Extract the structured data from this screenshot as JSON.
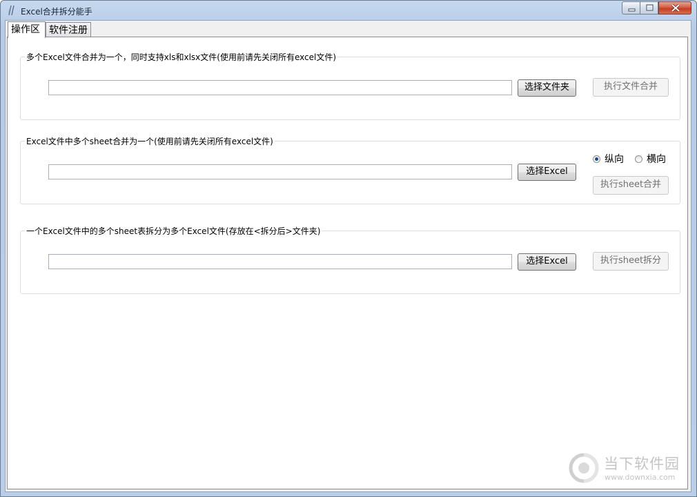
{
  "window": {
    "title": "Excel合并拆分能手",
    "controls": {
      "minimize_icon": "minimize-icon",
      "maximize_icon": "maximize-icon",
      "close_icon": "close-icon"
    }
  },
  "tabs": [
    {
      "label": "操作区",
      "active": true
    },
    {
      "label": "软件注册",
      "active": false
    }
  ],
  "groups": {
    "merge_files": {
      "title": "多个Excel文件合并为一个，同时支持xls和xlsx文件(使用前请先关闭所有excel文件)",
      "path_value": "",
      "select_label": "选择文件夹",
      "run_label": "执行文件合并"
    },
    "merge_sheets": {
      "title": "Excel文件中多个sheet合并为一个(使用前请先关闭所有excel文件)",
      "path_value": "",
      "select_label": "选择Excel",
      "run_label": "执行sheet合并",
      "orientation": {
        "options": [
          "纵向",
          "横向"
        ],
        "selected": "纵向"
      }
    },
    "split_sheets": {
      "title": "一个Excel文件中的多个sheet表拆分为多个Excel文件(存放在<拆分后>文件夹)",
      "path_value": "",
      "select_label": "选择Excel",
      "run_label": "执行sheet拆分"
    }
  },
  "watermark": {
    "name": "当下软件园",
    "url": "www.downxia.com"
  },
  "colors": {
    "titlebar": "#b9cfe8",
    "close_button": "#c23d25",
    "radio_selected": "#1c4a88"
  }
}
